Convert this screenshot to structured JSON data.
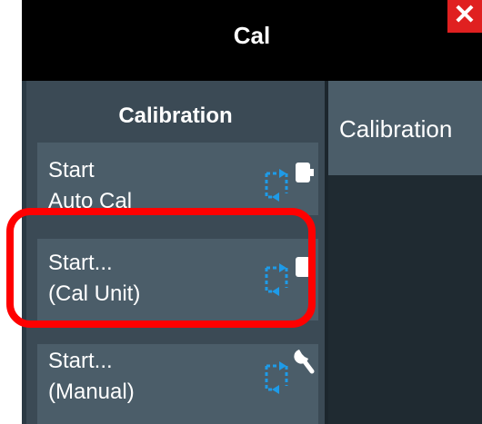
{
  "dialog": {
    "title": "Cal",
    "close_glyph": "✕"
  },
  "left": {
    "section_title": "Calibration",
    "buttons": [
      {
        "line1": "Start",
        "line2": "Auto Cal",
        "icon": "auto-cal-unit-icon"
      },
      {
        "line1": "Start...",
        "line2": "(Cal Unit)",
        "icon": "cal-unit-icon"
      },
      {
        "line1": "Start...",
        "line2": "(Manual)",
        "icon": "manual-cal-wrench-icon"
      }
    ]
  },
  "right": {
    "tab_label": "Calibration"
  },
  "colors": {
    "title_bar": "#000000",
    "panel": "#2b3a44",
    "button": "#4b5d69",
    "icon": "#1e9be8",
    "close": "#e02020",
    "highlight": "#ff0000"
  }
}
